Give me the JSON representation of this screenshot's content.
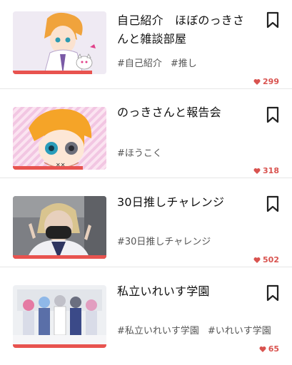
{
  "articles": [
    {
      "title": "自己紹介　ほぼのっきさんと雑談部屋",
      "tags": [
        "#自己紹介",
        "#推し"
      ],
      "likes": "299",
      "progress": 0.85,
      "thumb_icon": "anime-character-with-cat-thumbnail"
    },
    {
      "title": "のっきさんと報告会",
      "tags": [
        "#ほうこく"
      ],
      "likes": "318",
      "progress": 0.75,
      "thumb_icon": "anime-character-closeup-thumbnail"
    },
    {
      "title": "30日推しチャレンジ",
      "tags": [
        "#30日推しチャレンジ"
      ],
      "likes": "502",
      "progress": 1.0,
      "thumb_icon": "masked-person-photo-thumbnail"
    },
    {
      "title": "私立いれいす学園",
      "tags": [
        "#私立いれいす学園",
        "#いれいす学園"
      ],
      "likes": "65",
      "progress": 1.0,
      "thumb_icon": "group-illustration-thumbnail"
    }
  ],
  "colors": {
    "accent": "#e8534f",
    "likes": "#d9534f",
    "divider": "#e6e6e6"
  }
}
